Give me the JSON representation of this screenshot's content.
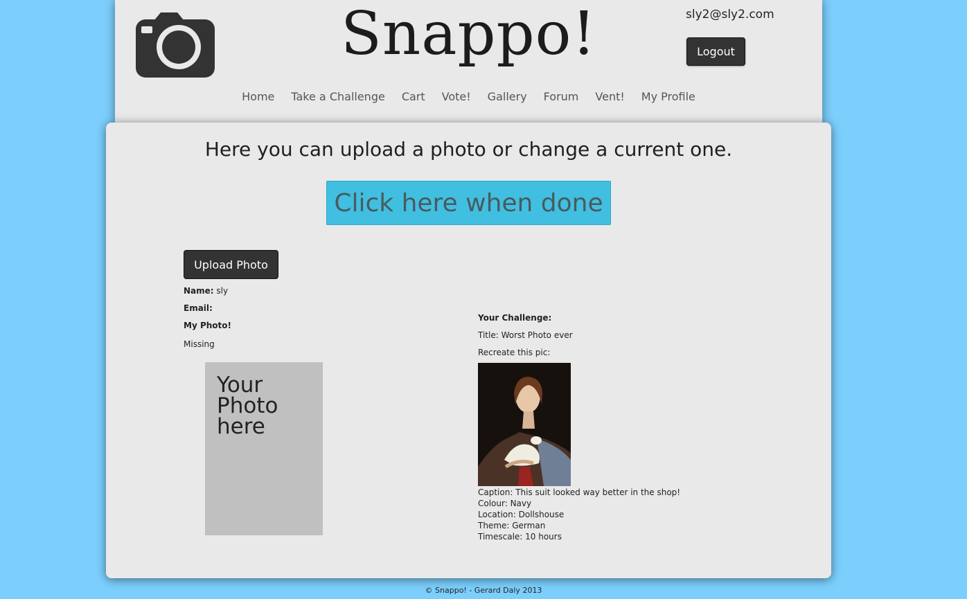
{
  "header": {
    "site_title": "Snappo!",
    "user_email": "sly2@sly2.com",
    "logout_label": "Logout",
    "nav": [
      "Home",
      "Take a Challenge",
      "Cart",
      "Vote!",
      "Gallery",
      "Forum",
      "Vent!",
      "My Profile"
    ]
  },
  "main": {
    "intro": "Here you can upload a photo or change a current one.",
    "done_button": "Click here when done",
    "upload_button": "Upload Photo",
    "name_label": "Name:",
    "name_value": "sly",
    "email_label": "Email:",
    "email_value": "",
    "my_photo_label": "My Photo!",
    "photo_status": "Missing",
    "placeholder_text": "Your Photo here"
  },
  "challenge": {
    "heading": "Your Challenge:",
    "title": "Title: Worst Photo ever",
    "recreate_label": "Recreate this pic:",
    "caption": "Caption: This suit looked way better in the shop!",
    "colour": "Colour: Navy",
    "location": "Location: Dollshouse",
    "theme": "Theme: German",
    "timescale": "Timescale: 10 hours"
  },
  "footer": {
    "text": "© Snappo! - Gerard Daly 2013"
  },
  "colors": {
    "background": "#7ccffd",
    "panel": "#e9e9e9",
    "accent": "#41bfe0",
    "dark_button": "#333333"
  },
  "icons": [
    "camera-icon"
  ]
}
